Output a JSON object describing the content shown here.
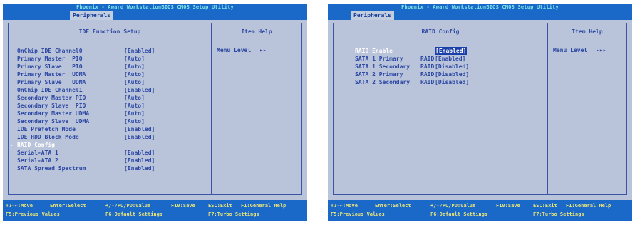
{
  "left": {
    "title": "Phoenix - Award WorkstationBIOS CMOS Setup Utility",
    "menu_tab": "Peripherals",
    "panel_title": "IDE Function Setup",
    "help_title": "Item Help",
    "help_menu_level": "Menu Level",
    "help_arrows": "▸▸",
    "items": [
      {
        "label": "OnChip IDE Channel0",
        "value": "[Enabled]"
      },
      {
        "label": "Primary Master  PIO",
        "value": "[Auto]"
      },
      {
        "label": "Primary Slave   PIO",
        "value": "[Auto]"
      },
      {
        "label": "Primary Master  UDMA",
        "value": "[Auto]"
      },
      {
        "label": "Primary Slave   UDMA",
        "value": "[Auto]"
      },
      {
        "label": "OnChip IDE Channel1",
        "value": "[Enabled]"
      },
      {
        "label": "Secondary Master PIO",
        "value": "[Auto]"
      },
      {
        "label": "Secondary Slave  PIO",
        "value": "[Auto]"
      },
      {
        "label": "Secondary Master UDMA",
        "value": "[Auto]"
      },
      {
        "label": "Secondary Slave  UDMA",
        "value": "[Auto]"
      },
      {
        "label": "IDE Prefetch Mode",
        "value": "[Enabled]"
      },
      {
        "label": "IDE HDD Block Mode",
        "value": "[Enabled]"
      },
      {
        "label": "RAID Config",
        "value": ""
      },
      {
        "label": "Serial-ATA 1",
        "value": "[Enabled]"
      },
      {
        "label": "Serial-ATA 2",
        "value": "[Enabled]"
      },
      {
        "label": "SATA Spread Spectrum",
        "value": "[Enabled]"
      }
    ],
    "raid_marker": "▸",
    "status": {
      "move": "↑↓→←:Move",
      "select": "Enter:Select",
      "value": "+/-/PU/PD:Value",
      "save": "F10:Save",
      "exit": "ESC:Exit",
      "general_help": "F1:General Help",
      "previous": "F5:Previous Values",
      "defaults": "F6:Default Settings",
      "turbo": "F7:Turbo Settings"
    }
  },
  "right": {
    "title": "Phoenix - Award WorkstationBIOS CMOS Setup Utility",
    "menu_tab": "Peripherals",
    "panel_title": "RAID Config",
    "help_title": "Item Help",
    "help_menu_level": "Menu Level",
    "help_arrows": "▸▸▸",
    "items": [
      {
        "label": "RAID Enable",
        "raid": "",
        "value": "[Enabled]"
      },
      {
        "label": "SATA 1 Primary",
        "raid": "RAID",
        "value": "[Enabled]"
      },
      {
        "label": "SATA 1 Secondary",
        "raid": "RAID",
        "value": "[Disabled]"
      },
      {
        "label": "SATA 2 Primary",
        "raid": "RAID",
        "value": "[Disabled]"
      },
      {
        "label": "SATA 2 Secondary",
        "raid": "RAID",
        "value": "[Disabled]"
      }
    ],
    "status": {
      "move": "↑↓→←:Move",
      "select": "Enter:Select",
      "value": "+/-/PU/PD:Value",
      "save": "F10:Save",
      "exit": "ESC:Exit",
      "general_help": "F1:General Help",
      "previous": "F5:Previous Values",
      "defaults": "F6:Default Settings",
      "turbo": "F7:Turbo Settings"
    }
  }
}
